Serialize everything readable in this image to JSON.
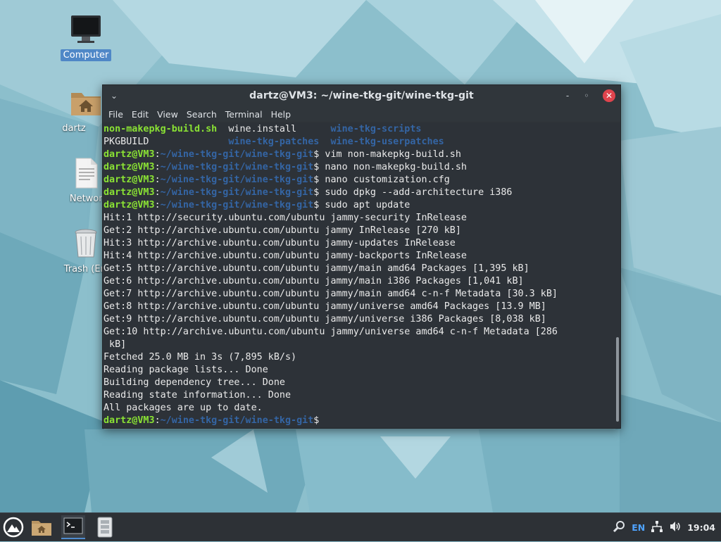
{
  "desktop": {
    "icons": [
      {
        "label": "Computer",
        "icon": "computer-icon",
        "selected": true
      },
      {
        "label": "dartz",
        "icon": "home-folder-icon"
      },
      {
        "label": "Network",
        "icon": "document-icon"
      },
      {
        "label": "Trash (Em",
        "icon": "trash-icon"
      }
    ]
  },
  "terminal": {
    "title": "dartz@VM3: ~/wine-tkg-git/wine-tkg-git",
    "controls": {
      "menu": "⌄",
      "minimize": "-",
      "maximize": "◦",
      "close": "✕"
    },
    "menu": [
      "File",
      "Edit",
      "View",
      "Search",
      "Terminal",
      "Help"
    ],
    "prompt_user": "dartz@VM3",
    "prompt_path": "~/wine-tkg-git/wine-tkg-git",
    "lines": [
      {
        "segs": [
          {
            "t": "non-makepkg-build.sh",
            "c": "c-green"
          },
          {
            "t": "  wine.install      "
          },
          {
            "t": "wine-tkg-scripts",
            "c": "c-blue"
          }
        ]
      },
      {
        "segs": [
          {
            "t": "PKGBUILD              "
          },
          {
            "t": "wine-tkg-patches  wine-tkg-userpatches",
            "c": "c-blue"
          }
        ]
      },
      {
        "prompt": true,
        "cmd": " vim non-makepkg-build.sh"
      },
      {
        "prompt": true,
        "cmd": " nano non-makepkg-build.sh"
      },
      {
        "prompt": true,
        "cmd": " nano customization.cfg"
      },
      {
        "prompt": true,
        "cmd": " sudo dpkg --add-architecture i386"
      },
      {
        "prompt": true,
        "cmd": " sudo apt update"
      },
      {
        "segs": [
          {
            "t": "Hit:1 http://security.ubuntu.com/ubuntu jammy-security InRelease"
          }
        ]
      },
      {
        "segs": [
          {
            "t": "Get:2 http://archive.ubuntu.com/ubuntu jammy InRelease [270 kB]"
          }
        ]
      },
      {
        "segs": [
          {
            "t": "Hit:3 http://archive.ubuntu.com/ubuntu jammy-updates InRelease"
          }
        ]
      },
      {
        "segs": [
          {
            "t": "Hit:4 http://archive.ubuntu.com/ubuntu jammy-backports InRelease"
          }
        ]
      },
      {
        "segs": [
          {
            "t": "Get:5 http://archive.ubuntu.com/ubuntu jammy/main amd64 Packages [1,395 kB]"
          }
        ]
      },
      {
        "segs": [
          {
            "t": "Get:6 http://archive.ubuntu.com/ubuntu jammy/main i386 Packages [1,041 kB]"
          }
        ]
      },
      {
        "segs": [
          {
            "t": "Get:7 http://archive.ubuntu.com/ubuntu jammy/main amd64 c-n-f Metadata [30.3 kB]"
          }
        ]
      },
      {
        "segs": [
          {
            "t": "Get:8 http://archive.ubuntu.com/ubuntu jammy/universe amd64 Packages [13.9 MB]"
          }
        ]
      },
      {
        "segs": [
          {
            "t": "Get:9 http://archive.ubuntu.com/ubuntu jammy/universe i386 Packages [8,038 kB]"
          }
        ]
      },
      {
        "segs": [
          {
            "t": "Get:10 http://archive.ubuntu.com/ubuntu jammy/universe amd64 c-n-f Metadata [286"
          }
        ]
      },
      {
        "segs": [
          {
            "t": " kB]"
          }
        ]
      },
      {
        "segs": [
          {
            "t": "Fetched 25.0 MB in 3s (7,895 kB/s)"
          }
        ]
      },
      {
        "segs": [
          {
            "t": "Reading package lists... Done"
          }
        ]
      },
      {
        "segs": [
          {
            "t": "Building dependency tree... Done"
          }
        ]
      },
      {
        "segs": [
          {
            "t": "Reading state information... Done"
          }
        ]
      },
      {
        "segs": [
          {
            "t": "All packages are up to date."
          }
        ]
      },
      {
        "prompt": true,
        "cmd": " "
      }
    ]
  },
  "taskbar": {
    "items": [
      "app-menu-icon",
      "file-manager-icon",
      "terminal-icon",
      "archive-icon"
    ],
    "tray": {
      "language": "EN",
      "clock": "19:04"
    }
  },
  "colors": {
    "prompt_user": "#8ae234",
    "prompt_path": "#3465a4",
    "accent": "#4f8ccf",
    "close": "#e0444d"
  }
}
